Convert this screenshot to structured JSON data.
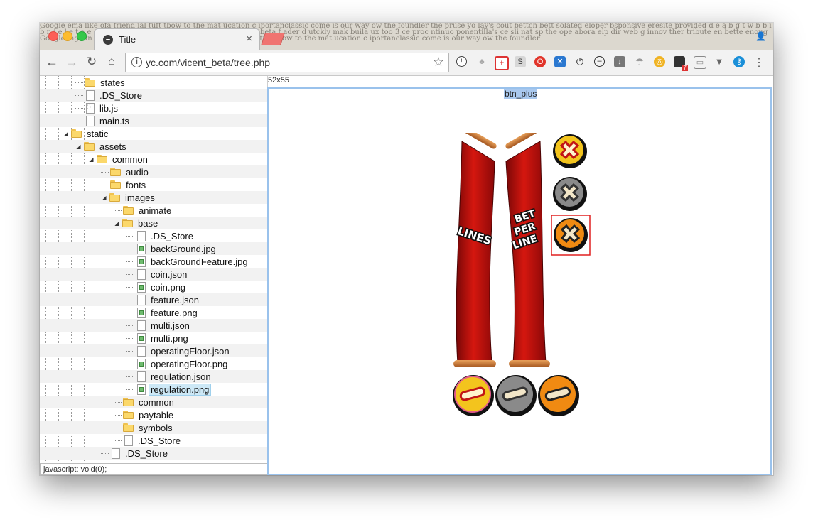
{
  "browser": {
    "tab_title": "Title",
    "tab_close": "×",
    "url": "yc.com/vicent_beta/tree.php",
    "nav": {
      "back": "←",
      "forward": "→",
      "reload": "↻",
      "home": "⌂"
    },
    "star": "☆",
    "menu": "⋮",
    "profile": "👤",
    "extension_badge": "7"
  },
  "tree": {
    "items": [
      {
        "name": "states",
        "type": "folder"
      },
      {
        "name": ".DS_Store",
        "type": "file"
      },
      {
        "name": "lib.js",
        "type": "js"
      },
      {
        "name": "main.ts",
        "type": "file"
      },
      {
        "name": "static",
        "type": "folder",
        "expanded": true
      },
      {
        "name": "assets",
        "type": "folder",
        "expanded": true
      },
      {
        "name": "common",
        "type": "folder",
        "expanded": true
      },
      {
        "name": "audio",
        "type": "folder"
      },
      {
        "name": "fonts",
        "type": "folder"
      },
      {
        "name": "images",
        "type": "folder",
        "expanded": true
      },
      {
        "name": "animate",
        "type": "folder"
      },
      {
        "name": "base",
        "type": "folder",
        "expanded": true
      },
      {
        "name": ".DS_Store",
        "type": "file"
      },
      {
        "name": "backGround.jpg",
        "type": "image"
      },
      {
        "name": "backGroundFeature.jpg",
        "type": "image"
      },
      {
        "name": "coin.json",
        "type": "file"
      },
      {
        "name": "coin.png",
        "type": "image"
      },
      {
        "name": "feature.json",
        "type": "file"
      },
      {
        "name": "feature.png",
        "type": "image"
      },
      {
        "name": "multi.json",
        "type": "file"
      },
      {
        "name": "multi.png",
        "type": "image"
      },
      {
        "name": "operatingFloor.json",
        "type": "file"
      },
      {
        "name": "operatingFloor.png",
        "type": "image"
      },
      {
        "name": "regulation.json",
        "type": "file"
      },
      {
        "name": "regulation.png",
        "type": "image",
        "selected": true
      },
      {
        "name": "common",
        "type": "folder"
      },
      {
        "name": "paytable",
        "type": "folder"
      },
      {
        "name": "symbols",
        "type": "folder"
      },
      {
        "name": ".DS_Store",
        "type": "file"
      },
      {
        "name": ".DS_Store",
        "type": "file"
      }
    ]
  },
  "status_bar": "javascript: void(0);",
  "preview": {
    "dimensions": "52x55",
    "sprite_name": "btn_plus",
    "banner_left": "LINES",
    "banner_right_lines": [
      "BET",
      "PER",
      "LINE"
    ]
  },
  "colors": {
    "selection": "#cde8f6",
    "preview_border": "#9ac2ec",
    "sprite_highlight": "#a9c8ee",
    "banner_red": "#c0120e",
    "btn_yellow": "#f3c41d",
    "btn_gray": "#8a8a8a",
    "btn_orange": "#f08a12"
  }
}
